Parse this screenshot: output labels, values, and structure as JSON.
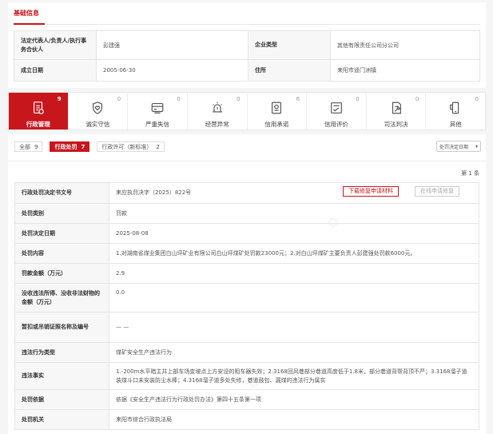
{
  "basic": {
    "title": "基础信息",
    "rows": [
      {
        "label1": "法定代表人/负责人/执行事务合伙人",
        "value1": "彭建强",
        "label2": "企业类型",
        "value2": "其他有限责任公司分公司"
      },
      {
        "label1": "成立日期",
        "value1": "2005-06-30",
        "label2": "住所",
        "value2": "耒阳市遥门洲镇"
      }
    ]
  },
  "tabs": [
    {
      "label": "行政管理",
      "count": "9",
      "icon": "file-list-icon",
      "active": true
    },
    {
      "label": "诚实守信",
      "count": "0",
      "icon": "shield-heart-icon",
      "active": false
    },
    {
      "label": "严重失信",
      "count": "0",
      "icon": "card-alert-icon",
      "active": false
    },
    {
      "label": "经营异常",
      "count": "0",
      "icon": "alarm-light-icon",
      "active": false
    },
    {
      "label": "信用承诺",
      "count": "6",
      "icon": "badge-doc-icon",
      "active": false
    },
    {
      "label": "信用评价",
      "count": "0",
      "icon": "rating-icon",
      "active": false
    },
    {
      "label": "司法判决",
      "count": "0",
      "icon": "gavel-doc-icon",
      "active": false
    },
    {
      "label": "其他",
      "count": "0",
      "icon": "phone-icon",
      "active": false
    }
  ],
  "filters": [
    {
      "label": "全部",
      "count": "9",
      "active": false
    },
    {
      "label": "行政处罚",
      "count": "7",
      "active": true
    },
    {
      "label": "行政许可（新标准）",
      "count": "2",
      "active": false
    }
  ],
  "sort": {
    "label": "处罚决定日期"
  },
  "record_count": "第 1 条",
  "buttons": {
    "download": "下载修复申请材料",
    "online": "在线申请修复"
  },
  "detail": [
    {
      "label": "行政处罚决定书文号",
      "value": "耒应执罚决字（2025）822号"
    },
    {
      "label": "处罚类别",
      "value": "罚款"
    },
    {
      "label": "处罚决定日期",
      "value": "2025-08-08"
    },
    {
      "label": "处罚内容",
      "value": "1.对湖南省煤业集团白山坪矿业有限公司白山坪煤矿处罚款23000元；2.对白山坪煤矿主要负责人彭建强处罚款6000元。"
    },
    {
      "label": "罚款金额（万元）",
      "value": "2.9"
    },
    {
      "label": "没收违法所得、没收非法财物的金额（万元）",
      "value": "0.0"
    },
    {
      "label": "暂扣或吊销证照名称及编号",
      "value": "— —"
    },
    {
      "label": "违法行为类型",
      "value": "煤矿安全生产违法行为"
    },
    {
      "label": "违法事实",
      "value": "1.-200m水平暗主井上部车场变坡点上方安设的阻车器失效；2.3168回风巷部分巷道高度低于1.8米，部分巷道背帮背顶不严；3.3168溜子道装煤斗口未安装防尘水棒；4.3168溜子道多处失修，巷道鼓包、漏煤的违法行为属实"
    },
    {
      "label": "处罚依据",
      "value": "依据《安全生产违法行为行政处罚办法》第四十五条第一项"
    },
    {
      "label": "处罚机关",
      "value": "耒阳市综合行政执法局"
    }
  ]
}
